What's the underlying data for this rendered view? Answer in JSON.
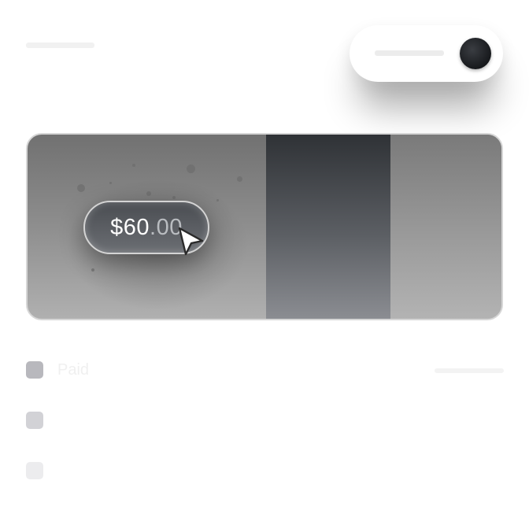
{
  "price": {
    "main": "$60",
    "decimals": ".00"
  },
  "list": {
    "items": [
      {
        "label": "Paid"
      },
      {
        "label": ""
      },
      {
        "label": ""
      }
    ]
  },
  "colors": {
    "toggle_knob": "#1a1c1f",
    "card_band_dark": "#2f3236",
    "price_text": "#ffffff"
  },
  "icons": {
    "cursor": "pointer-arrow-icon"
  }
}
